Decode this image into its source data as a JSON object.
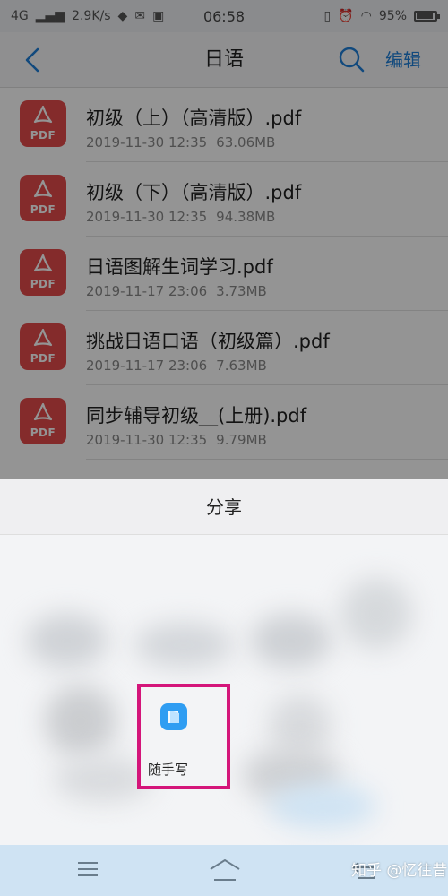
{
  "status_bar": {
    "network": "4G",
    "speed": "2.9K/s",
    "time": "06:58",
    "battery": "95%"
  },
  "header": {
    "title": "日语",
    "edit_label": "编辑",
    "icons": [
      "back-icon",
      "search-icon"
    ]
  },
  "files": [
    {
      "name": "初级（上）（高清版）.pdf",
      "date": "2019-11-30 12:35",
      "size": "63.06MB",
      "icon_label": "PDF"
    },
    {
      "name": "初级（下）（高清版）.pdf",
      "date": "2019-11-30 12:35",
      "size": "94.38MB",
      "icon_label": "PDF"
    },
    {
      "name": "日语图解生词学习.pdf",
      "date": "2019-11-17 23:06",
      "size": "3.73MB",
      "icon_label": "PDF"
    },
    {
      "name": "挑战日语口语（初级篇）.pdf",
      "date": "2019-11-17 23:06",
      "size": "7.63MB",
      "icon_label": "PDF"
    },
    {
      "name": "同步辅导初级__(上册).pdf",
      "date": "2019-11-30 12:35",
      "size": "9.79MB",
      "icon_label": "PDF"
    }
  ],
  "share_sheet": {
    "title": "分享",
    "highlighted_app": {
      "label": "随手写",
      "icon": "notebook-app-icon"
    }
  },
  "nav_bar": {
    "icons": [
      "menu-icon",
      "home-icon",
      "return-icon"
    ],
    "watermark": "知乎 @忆往昔"
  },
  "colors": {
    "accent": "#1e7fd8",
    "pdf_red": "#e34a4a",
    "highlight_border": "#d4157a",
    "app_blue": "#2f9df2",
    "nav_bar_bg": "#cfe3f3"
  }
}
